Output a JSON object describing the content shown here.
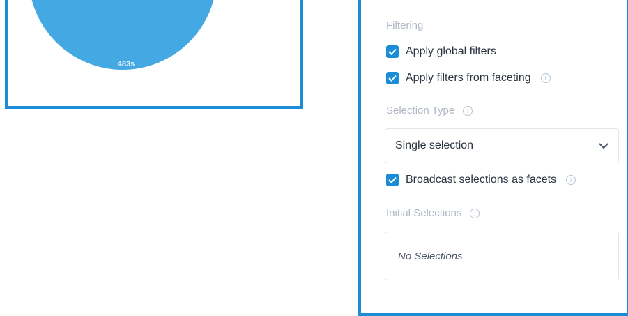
{
  "chart": {
    "center_label": "483s",
    "color": "#44a9e2"
  },
  "panel": {
    "filtering_label": "Filtering",
    "apply_global_filters": {
      "label": "Apply global filters",
      "checked": true
    },
    "apply_filters_from_faceting": {
      "label": "Apply filters from faceting",
      "checked": true
    },
    "selection_type_label": "Selection Type",
    "selection_type_value": "Single selection",
    "broadcast_selections": {
      "label": "Broadcast selections as facets",
      "checked": true
    },
    "initial_selections_label": "Initial Selections",
    "initial_selections_value": "No Selections"
  },
  "colors": {
    "accent": "#1b8dd6",
    "muted_label": "#b0b8c4"
  }
}
